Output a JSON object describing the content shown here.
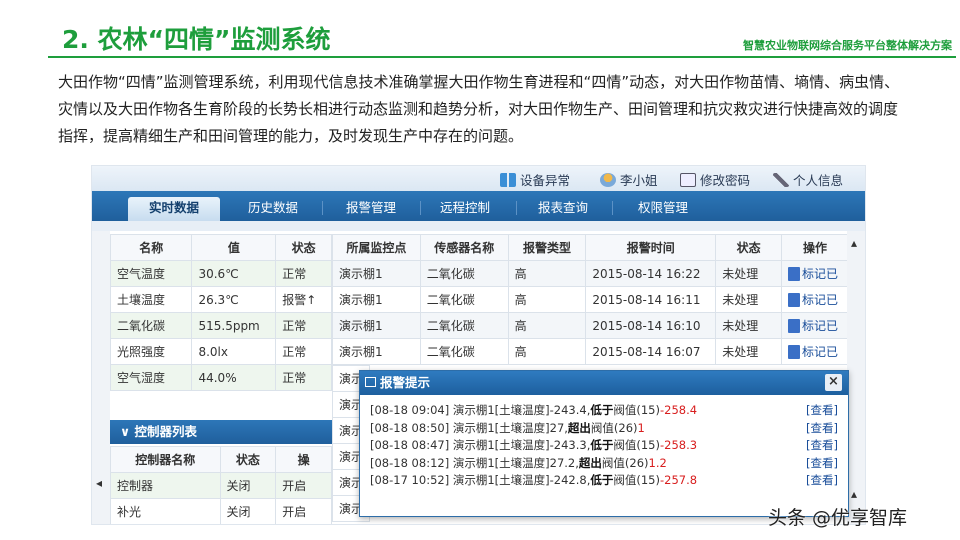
{
  "slide": {
    "title": "2. 农林“四情”监测系统",
    "subtitle": "智慧农业物联网综合服务平台整体解决方案",
    "intro": "大田作物“四情”监测管理系统，利用现代信息技术准确掌握大田作物生育进程和“四情”动态，对大田作物苗情、墒情、病虫情、灾情以及大田作物各生育阶段的长势长相进行动态监测和趋势分析，对大田作物生产、田间管理和抗灾救灾进行快捷高效的调度指挥，提高精细生产和田间管理的能力，及时发现生产中存在的问题。"
  },
  "topbar": {
    "device_alarm": "设备异常",
    "user": "李小姐",
    "change_password": "修改密码",
    "profile": "个人信息"
  },
  "tabs": [
    "实时数据",
    "历史数据",
    "报警管理",
    "远程控制",
    "报表查询",
    "权限管理"
  ],
  "sensors": {
    "headers": [
      "名称",
      "值",
      "状态"
    ],
    "rows": [
      [
        "空气温度",
        "30.6℃",
        "正常"
      ],
      [
        "土壤温度",
        "26.3℃",
        "报警↑"
      ],
      [
        "二氧化碳",
        "515.5ppm",
        "正常"
      ],
      [
        "光照强度",
        "8.0lx",
        "正常"
      ],
      [
        "空气湿度",
        "44.0%",
        "正常"
      ]
    ]
  },
  "alarms": {
    "headers": [
      "所属监控点",
      "传感器名称",
      "报警类型",
      "报警时间",
      "状态",
      "操作"
    ],
    "rows": [
      [
        "演示棚1",
        "二氧化碳",
        "高",
        "2015-08-14 16:22",
        "未处理",
        "标记已"
      ],
      [
        "演示棚1",
        "二氧化碳",
        "高",
        "2015-08-14 16:11",
        "未处理",
        "标记已"
      ],
      [
        "演示棚1",
        "二氧化碳",
        "高",
        "2015-08-14 16:10",
        "未处理",
        "标记已"
      ],
      [
        "演示棚1",
        "二氧化碳",
        "高",
        "2015-08-14 16:07",
        "未处理",
        "标记已"
      ]
    ],
    "partial_cells": [
      "演示",
      "演示",
      "演示",
      "演示",
      "演示",
      "演示"
    ]
  },
  "controllers": {
    "title": "∨ 控制器列表",
    "headers": [
      "控制器名称",
      "状态",
      "操"
    ],
    "rows": [
      [
        "控制器",
        "关闭",
        "开启"
      ],
      [
        "补光",
        "关闭",
        "开启"
      ]
    ]
  },
  "popup": {
    "title": "报警提示",
    "close": "×",
    "alerts": [
      {
        "time": "[08-18 09:04]",
        "text": "演示棚1[土壤温度]-243.4,",
        "cmp": "低于",
        "suffix": "阀值(15)",
        "value": "-258.4",
        "view": "[查看]"
      },
      {
        "time": "[08-18 08:50]",
        "text": "演示棚1[土壤温度]27,",
        "cmp": "超出",
        "suffix": "阀值(26)",
        "value": "1",
        "view": "[查看]"
      },
      {
        "time": "[08-18 08:47]",
        "text": "演示棚1[土壤温度]-243.3,",
        "cmp": "低于",
        "suffix": "阀值(15)",
        "value": "-258.3",
        "view": "[查看]"
      },
      {
        "time": "[08-18 08:12]",
        "text": "演示棚1[土壤温度]27.2,",
        "cmp": "超出",
        "suffix": "阀值(26)",
        "value": "1.2",
        "view": "[查看]"
      },
      {
        "time": "[08-17 10:52]",
        "text": "演示棚1[土壤温度]-242.8,",
        "cmp": "低于",
        "suffix": "阀值(15)",
        "value": "-257.8",
        "view": "[查看]"
      }
    ]
  },
  "watermark": "头条 @优享智库"
}
